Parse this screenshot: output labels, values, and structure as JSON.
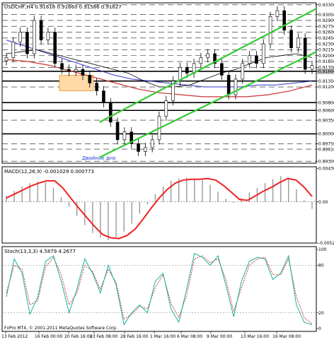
{
  "chart_data": [
    {
      "type": "candlestick",
      "title": "USDCHF,H4  0.91616 0.91660 0.91586 0.91627",
      "symbol": "USDCHF",
      "timeframe": "H4",
      "ohlc": {
        "open": 0.91616,
        "high": 0.9166,
        "low": 0.91586,
        "close": 0.91627
      },
      "ylim": [
        0.8925,
        0.9335
      ],
      "y_ticks": [
        "0.93300",
        "0.93050",
        "0.92900",
        "0.92750",
        "0.92600",
        "0.92450",
        "0.92300",
        "0.92150",
        "0.92000",
        "0.91850",
        "0.91700",
        "0.91600",
        "0.91350",
        "0.91200",
        "0.90800",
        "0.90600",
        "0.90350",
        "0.90000",
        "0.89750",
        "0.89610",
        "0.89300"
      ],
      "highlighted_levels": [
        "0.91600",
        "0.91350",
        "0.90800",
        "0.90600",
        "0.90000"
      ],
      "price_marker": "0.91600",
      "annotation": "Двойное дно",
      "series": [
        {
          "name": "price",
          "values": [
            0.9195,
            0.9235,
            0.926,
            0.9205,
            0.929,
            0.924,
            0.926,
            0.918,
            0.9165,
            0.916,
            0.9165,
            0.915,
            0.913,
            0.911,
            0.908,
            0.903,
            0.8985,
            0.9005,
            0.8975,
            0.8955,
            0.8965,
            0.8985,
            0.9045,
            0.9085,
            0.9135,
            0.917,
            0.9155,
            0.918,
            0.9195,
            0.9205,
            0.918,
            0.915,
            0.91,
            0.914,
            0.918,
            0.92,
            0.918,
            0.923,
            0.93,
            0.9315,
            0.9265,
            0.922,
            0.9245,
            0.9165,
            0.9175
          ]
        },
        {
          "name": "ma-fast",
          "values": [
            0.9205,
            0.921,
            0.9215,
            0.9205,
            0.9195,
            0.9185,
            0.9175,
            0.9165,
            0.9155,
            0.9135,
            0.912,
            0.912,
            0.9125,
            0.914,
            0.9155,
            0.9165,
            0.918,
            0.9195,
            0.92,
            0.9205,
            0.9195
          ]
        },
        {
          "name": "ma-mid",
          "values": [
            0.924,
            0.9225,
            0.921,
            0.9195,
            0.918,
            0.9165,
            0.915,
            0.914,
            0.9135,
            0.913,
            0.9125,
            0.912,
            0.912,
            0.912,
            0.9125,
            0.9125,
            0.913,
            0.9135
          ]
        },
        {
          "name": "ma-slow",
          "values": [
            0.919,
            0.9185,
            0.9175,
            0.916,
            0.9145,
            0.913,
            0.9115,
            0.9105,
            0.91,
            0.9095,
            0.9095,
            0.9095,
            0.91,
            0.911,
            0.9125
          ]
        }
      ],
      "channel_lines": [
        {
          "name": "lower-channel",
          "from": [
            0,
            0.894
          ],
          "to": [
            1,
            0.921
          ]
        },
        {
          "name": "upper-channel",
          "from": [
            0,
            0.903
          ],
          "to": [
            1,
            0.932
          ]
        }
      ],
      "resistance_box": {
        "from": [
          0.9135,
          0.915
        ],
        "to": [
          0.9095,
          0.911
        ]
      },
      "colors": {
        "candles": "#000000",
        "channel": "#33cc33",
        "ma-fast": "#000000",
        "ma-mid": "#3333cc",
        "ma-slow": "#cc3333",
        "support": "#000000",
        "highlight-fill": "#ffd9a6",
        "highlight-stroke": "#e8a450"
      }
    },
    {
      "type": "histogram+line",
      "title": "MACD(12,26,9) -0.001029 0.000773",
      "ylim": [
        -0.00528,
        0.0045
      ],
      "y_ticks": [
        "0.00430",
        "0.00",
        "-0.00528"
      ],
      "series": [
        {
          "name": "signal",
          "values": [
            0.0005,
            0.001,
            0.0015,
            0.002,
            0.0024,
            0.0027,
            0.0027,
            0.0018,
            0.0005,
            -0.0008,
            -0.002,
            -0.0032,
            -0.0042,
            -0.0046,
            -0.0047,
            -0.0043,
            -0.0035,
            -0.0022,
            -0.0008,
            0.0005,
            0.0016,
            0.0024,
            0.0028,
            0.0029,
            0.0029,
            0.003,
            0.0028,
            0.0021,
            0.0012,
            0.0003,
            0.0002,
            0.0008,
            0.0014,
            0.0019,
            0.0025,
            0.003,
            0.0028,
            0.0019,
            0.0007
          ]
        },
        {
          "name": "histogram",
          "values": [
            0.0008,
            0.0014,
            0.002,
            0.0024,
            0.0026,
            0.0025,
            0.0018,
            0.0006,
            -0.0006,
            -0.0018,
            -0.003,
            -0.004,
            -0.0046,
            -0.0049,
            -0.0045,
            -0.0038,
            -0.0028,
            -0.0015,
            -0.0003,
            0.001,
            0.002,
            0.0027,
            0.003,
            0.0031,
            0.003,
            0.0028,
            0.0022,
            0.0013,
            0.0004,
            -0.0001,
            0.0005,
            0.0012,
            0.0018,
            0.0024,
            0.0029,
            0.0033,
            0.0029,
            0.0016,
            0.0002,
            -0.0009
          ]
        }
      ],
      "colors": {
        "signal": "#ee2222",
        "histogram": "#9a9a9a"
      }
    },
    {
      "type": "line",
      "title": "Stoch(13,3,3) 4.5879 4.2677",
      "ylim": [
        0,
        100
      ],
      "y_ticks": [
        "100",
        "80",
        "20",
        "0"
      ],
      "series": [
        {
          "name": "%K",
          "values": [
            40,
            88,
            70,
            18,
            40,
            85,
            92,
            60,
            20,
            50,
            88,
            70,
            45,
            80,
            55,
            5,
            20,
            30,
            20,
            60,
            70,
            25,
            8,
            50,
            95,
            90,
            80,
            92,
            55,
            15,
            60,
            85,
            90,
            88,
            62,
            70,
            92,
            30,
            8,
            5
          ]
        },
        {
          "name": "%D",
          "values": [
            45,
            80,
            75,
            30,
            35,
            78,
            90,
            68,
            30,
            45,
            80,
            72,
            50,
            75,
            58,
            12,
            18,
            28,
            25,
            52,
            68,
            32,
            14,
            42,
            88,
            92,
            83,
            88,
            62,
            22,
            52,
            80,
            88,
            90,
            68,
            68,
            88,
            40,
            14,
            6
          ]
        }
      ],
      "colors": {
        "%K": "#00aa99",
        "%D": "#cc2222"
      }
    }
  ],
  "x_ticks": [
    "13 Feb 2012",
    "16 Feb 00:00",
    "20 Feb 16:00",
    "23 Feb 08:00",
    "28 Feb 16:00",
    "1 Mar 16:00",
    "6 Mar 08:00",
    "9 Mar 00:00",
    "13 Mar 16:00",
    "16 Mar 08:00"
  ],
  "footer": "FxPro MT4, © 2001-2011 MetaQuotes Software Corp."
}
